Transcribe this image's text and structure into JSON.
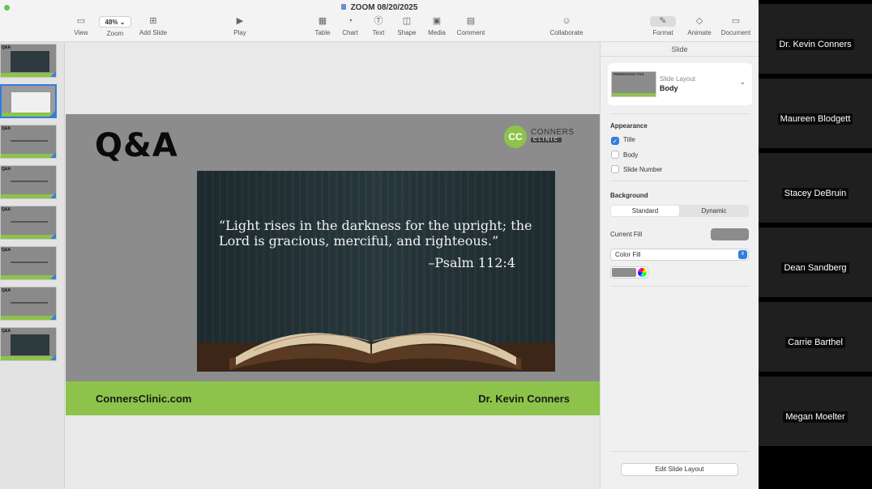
{
  "window": {
    "title": "ZOOM 08/20/2025"
  },
  "toolbar": {
    "view": "View",
    "zoom_value": "48%",
    "zoom": "Zoom",
    "add_slide": "Add Slide",
    "play": "Play",
    "table": "Table",
    "chart": "Chart",
    "text": "Text",
    "shape": "Shape",
    "media": "Media",
    "comment": "Comment",
    "collaborate": "Collaborate",
    "format": "Format",
    "animate": "Animate",
    "document": "Document"
  },
  "navigator": {
    "thumb_title": "Q&A"
  },
  "slide": {
    "title": "Q&A",
    "logo_name": "CONNERS",
    "logo_sub": "CLINIC",
    "logo_initials": "CC",
    "quote": "“Light rises in the darkness for the upright; the Lord is gracious, merciful, and righteous.”",
    "citation": "–Psalm 112:4",
    "footer_left": "ConnersClinic.com",
    "footer_right": "Dr. Kevin Conners"
  },
  "inspector": {
    "header": "Slide",
    "layout_label": "Slide Layout",
    "layout_value": "Body",
    "layout_thumb_text": "PRESENTATION TITLE",
    "appearance": "Appearance",
    "chk_title": "Title",
    "chk_body": "Body",
    "chk_slide_number": "Slide Number",
    "background": "Background",
    "seg_standard": "Standard",
    "seg_dynamic": "Dynamic",
    "current_fill": "Current Fill",
    "fill_type": "Color Fill",
    "edit_layout": "Edit Slide Layout"
  },
  "participants": [
    "Dr. Kevin Conners",
    "Maureen Blodgett",
    "Stacey DeBruin",
    "Dean Sandberg",
    "Carrie Barthel",
    "Megan Moelter"
  ]
}
